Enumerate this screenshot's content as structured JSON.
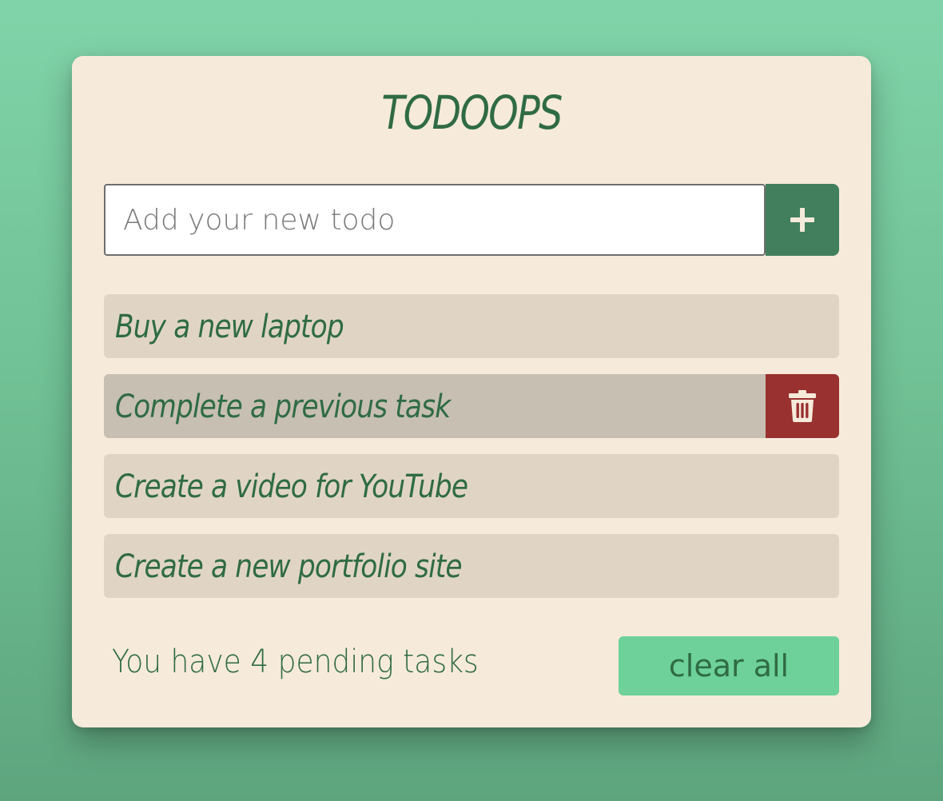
{
  "app": {
    "title": "TODOOPS"
  },
  "input": {
    "placeholder": "Add your new todo",
    "value": "",
    "add_icon": "plus-icon"
  },
  "todos": [
    {
      "text": "Buy a new laptop",
      "hovered": false
    },
    {
      "text": "Complete a previous task",
      "hovered": true,
      "delete_icon": "trash-icon"
    },
    {
      "text": "Create a video for YouTube",
      "hovered": false
    },
    {
      "text": "Create a new portfolio site",
      "hovered": false
    }
  ],
  "footer": {
    "pending_text": "You have 4 pending tasks",
    "clear_label": "clear all"
  },
  "colors": {
    "accent_text": "#2f6b44",
    "add_button": "#417f5d",
    "delete_button": "#98312f",
    "clear_button": "#6dd199",
    "card_background": "#f6eadb"
  }
}
